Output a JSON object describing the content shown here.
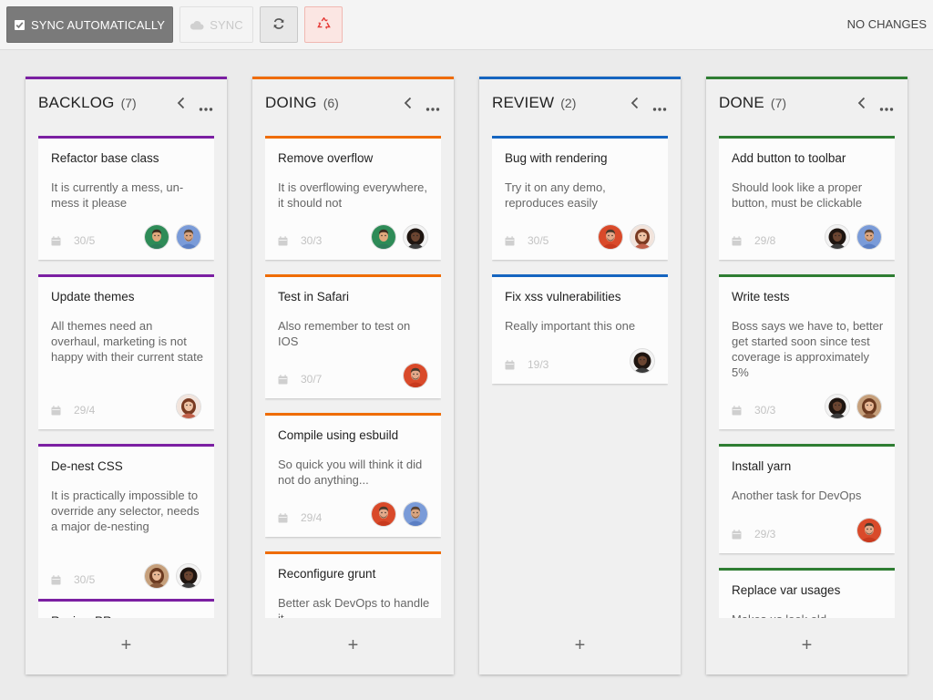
{
  "toolbar": {
    "sync_auto_label": "SYNC AUTOMATICALLY",
    "sync_label": "SYNC",
    "refresh_icon": "refresh-icon",
    "recycle_icon": "recycle-icon",
    "status": "NO CHANGES"
  },
  "colors": {
    "backlog": "#7b1fa2",
    "doing": "#ef6c00",
    "review": "#1565c0",
    "done": "#2e7d32"
  },
  "columns": [
    {
      "id": "backlog",
      "title": "BACKLOG",
      "count": "(7)",
      "cards": [
        {
          "title": "Refactor base class",
          "desc": "It is currently a mess, un-mess it please",
          "date": "30/5",
          "avatars": [
            "man-green",
            "man-blue"
          ]
        },
        {
          "title": "Update themes",
          "desc": "All themes need an overhaul, marketing is not happy with their current state",
          "date": "29/4",
          "avatars": [
            "woman-red"
          ]
        },
        {
          "title": "De-nest CSS",
          "desc": "It is practically impossible to override any selector, needs a major de-nesting",
          "date": "30/5",
          "avatars": [
            "woman-brown",
            "woman-curly"
          ]
        },
        {
          "title": "Review PR",
          "desc": "",
          "date": "",
          "avatars": []
        }
      ]
    },
    {
      "id": "doing",
      "title": "DOING",
      "count": "(6)",
      "cards": [
        {
          "title": "Remove overflow",
          "desc": "It is overflowing everywhere, it should not",
          "date": "30/3",
          "avatars": [
            "man-green",
            "woman-curly"
          ]
        },
        {
          "title": "Test in Safari",
          "desc": "Also remember to test on IOS",
          "date": "30/7",
          "avatars": [
            "man-red"
          ]
        },
        {
          "title": "Compile using esbuild",
          "desc": "So quick you will think it did not do anything...",
          "date": "29/4",
          "avatars": [
            "man-red",
            "man-blue"
          ]
        },
        {
          "title": "Reconfigure grunt",
          "desc": "Better ask DevOps to handle it",
          "date": "",
          "avatars": []
        }
      ]
    },
    {
      "id": "review",
      "title": "REVIEW",
      "count": "(2)",
      "cards": [
        {
          "title": "Bug with rendering",
          "desc": "Try it on any demo, reproduces easily",
          "date": "30/5",
          "avatars": [
            "man-red",
            "woman-red"
          ]
        },
        {
          "title": "Fix xss vulnerabilities",
          "desc": "Really important this one",
          "date": "19/3",
          "avatars": [
            "woman-curly"
          ]
        }
      ]
    },
    {
      "id": "done",
      "title": "DONE",
      "count": "(7)",
      "cards": [
        {
          "title": "Add button to toolbar",
          "desc": "Should look like a proper button, must be clickable",
          "date": "29/8",
          "avatars": [
            "woman-curly",
            "man-blue"
          ]
        },
        {
          "title": "Write tests",
          "desc": "Boss says we have to, better get started soon since test coverage is approximately 5%",
          "date": "30/3",
          "avatars": [
            "woman-curly",
            "woman-brown"
          ]
        },
        {
          "title": "Install yarn",
          "desc": "Another task for DevOps",
          "date": "29/3",
          "avatars": [
            "man-red"
          ]
        },
        {
          "title": "Replace var usages",
          "desc": "Makes us look old",
          "date": "",
          "avatars": []
        }
      ]
    }
  ],
  "add_label": "+"
}
